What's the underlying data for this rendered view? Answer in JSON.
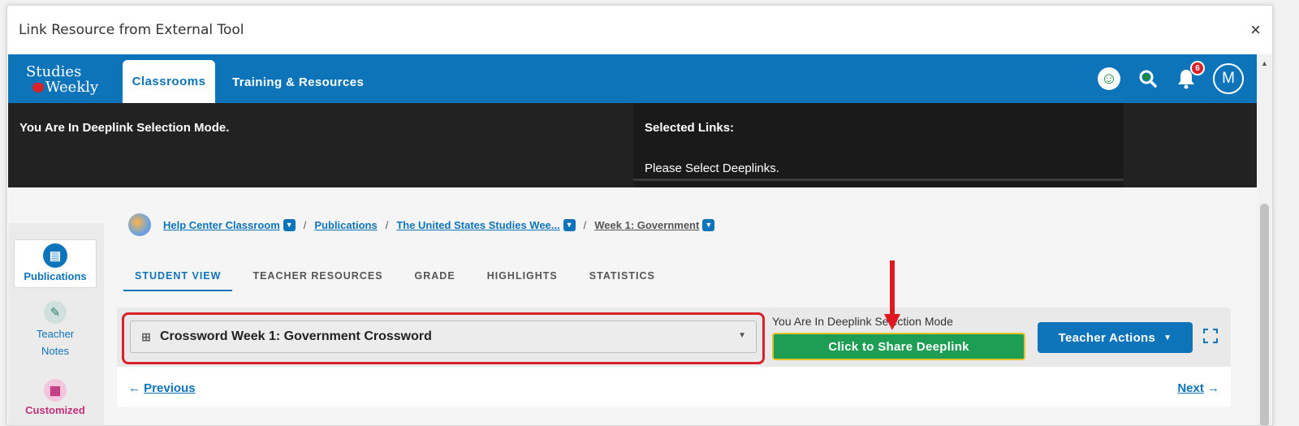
{
  "modal": {
    "title": "Link Resource from External Tool",
    "close": "×"
  },
  "logo": {
    "line1": "Studies",
    "line2": "Weekly"
  },
  "nav": {
    "classrooms": "Classrooms",
    "training": "Training & Resources",
    "notification_count": "6",
    "avatar_initial": "M"
  },
  "deeplink": {
    "mode_text": "You Are In Deeplink Selection Mode.",
    "selected_title": "Selected Links:",
    "selected_placeholder": "Please Select Deeplinks."
  },
  "sidebar": {
    "publications": "Publications",
    "teacher_notes_1": "Teacher",
    "teacher_notes_2": "Notes",
    "customized": "Customized"
  },
  "breadcrumb": {
    "classroom": "Help Center Classroom",
    "publications": "Publications",
    "publication": "The United States Studies Wee...",
    "week": "Week 1: Government"
  },
  "tabs": [
    "STUDENT VIEW",
    "TEACHER RESOURCES",
    "GRADE",
    "HIGHLIGHTS",
    "STATISTICS"
  ],
  "select": {
    "value": "Crossword Week 1: Government Crossword"
  },
  "share": {
    "mode_label": "You Are In Deeplink Selection Mode",
    "button": "Click to Share Deeplink"
  },
  "teacher_actions": "Teacher Actions",
  "pager": {
    "previous": "Previous",
    "next": "Next"
  },
  "colors": {
    "brand_blue": "#0e74b9",
    "share_green": "#1e9e55",
    "highlight_red": "#d62228"
  }
}
